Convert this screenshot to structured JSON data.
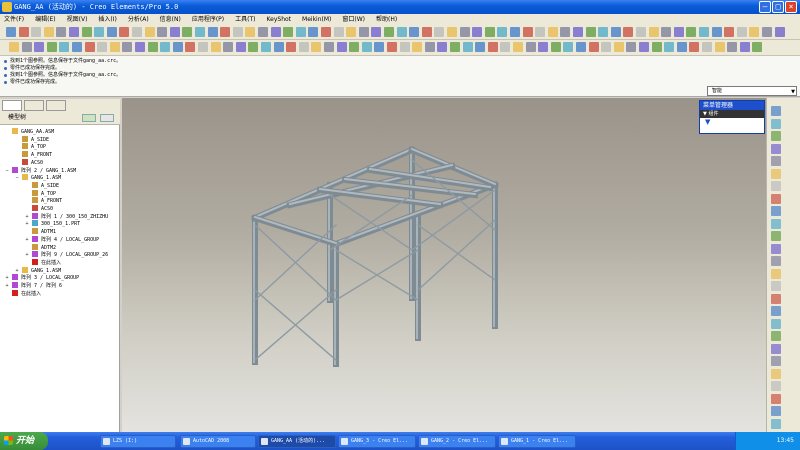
{
  "window": {
    "title": "GANG_AA (活动的) - Creo Elements/Pro 5.0"
  },
  "menu": [
    "文件(F)",
    "编辑(E)",
    "视图(V)",
    "插入(I)",
    "分析(A)",
    "信息(N)",
    "应用程序(P)",
    "工具(T)",
    "KeyShot",
    "Meikin(M)",
    "窗口(W)",
    "帮助(H)"
  ],
  "messages": [
    "找到1个图参照。信息保存于文件gang_aa.crc。",
    "零件已成功保存完成。",
    "找到1个图参照。信息保存于文件gang_aa.crc。",
    "零件已成功保存完成。"
  ],
  "selection_filter": {
    "value": "智能"
  },
  "model_tree": {
    "header": "模型树",
    "items": [
      {
        "label": "GANG_AA.ASM",
        "icon": "assembly-icon",
        "indent": 0,
        "expander": ""
      },
      {
        "label": "A_SIDE",
        "icon": "datum-plane-icon",
        "indent": 1,
        "expander": ""
      },
      {
        "label": "A_TOP",
        "icon": "datum-plane-icon",
        "indent": 1,
        "expander": ""
      },
      {
        "label": "A_FRONT",
        "icon": "datum-plane-icon",
        "indent": 1,
        "expander": ""
      },
      {
        "label": "ACS0",
        "icon": "csys-icon",
        "indent": 1,
        "expander": ""
      },
      {
        "label": "阵列 2 / GANG_1.ASM",
        "icon": "pattern-icon",
        "indent": 0,
        "expander": "−"
      },
      {
        "label": "GANG_1.ASM",
        "icon": "assembly-icon",
        "indent": 1,
        "expander": "−"
      },
      {
        "label": "A_SIDE",
        "icon": "datum-plane-icon",
        "indent": 2,
        "expander": ""
      },
      {
        "label": "A_TOP",
        "icon": "datum-plane-icon",
        "indent": 2,
        "expander": ""
      },
      {
        "label": "A_FRONT",
        "icon": "datum-plane-icon",
        "indent": 2,
        "expander": ""
      },
      {
        "label": "ACS0",
        "icon": "csys-icon",
        "indent": 2,
        "expander": ""
      },
      {
        "label": "阵列 1 / 300_150_ZHIZHU",
        "icon": "pattern-icon",
        "indent": 2,
        "expander": "+"
      },
      {
        "label": "300_150_1.PRT",
        "icon": "part-icon",
        "indent": 2,
        "expander": "+"
      },
      {
        "label": "ADTM1",
        "icon": "datum-plane-icon",
        "indent": 2,
        "expander": ""
      },
      {
        "label": "阵列 4 / LOCAL_GROUP",
        "icon": "pattern-icon",
        "indent": 2,
        "expander": "+"
      },
      {
        "label": "ADTM2",
        "icon": "datum-plane-icon",
        "indent": 2,
        "expander": ""
      },
      {
        "label": "阵列 9 / LOCAL_GROUP_26",
        "icon": "pattern-icon",
        "indent": 2,
        "expander": "+"
      },
      {
        "label": "在此插入",
        "icon": "insert-here-icon",
        "indent": 2,
        "expander": ""
      },
      {
        "label": "GANG_1.ASM",
        "icon": "assembly-icon",
        "indent": 1,
        "expander": "+"
      },
      {
        "label": "阵列 3 / LOCAL_GROUP",
        "icon": "pattern-icon",
        "indent": 0,
        "expander": "+"
      },
      {
        "label": "阵列 7 / 阵列 6",
        "icon": "pattern-icon",
        "indent": 0,
        "expander": "+"
      },
      {
        "label": "在此插入",
        "icon": "insert-here-icon",
        "indent": 0,
        "expander": ""
      }
    ]
  },
  "menu_manager": {
    "title": "菜单管理器",
    "section": "组件"
  },
  "taskbar": {
    "start_label": "开始",
    "tasks": [
      "LZS (I:)",
      "AutoCAD 2008",
      "GANG_AA (活动的)...",
      "GANG_3 - Creo El...",
      "GANG_2 - Creo El...",
      "GANG_1 - Creo El..."
    ],
    "clock": "13:45"
  },
  "colors": {
    "titlebar": "#0a5cd8",
    "taskbar": "#245edb",
    "viewport_top": "#9a938a",
    "viewport_bottom": "#e4e3df",
    "frame": "#8e9ba3"
  }
}
